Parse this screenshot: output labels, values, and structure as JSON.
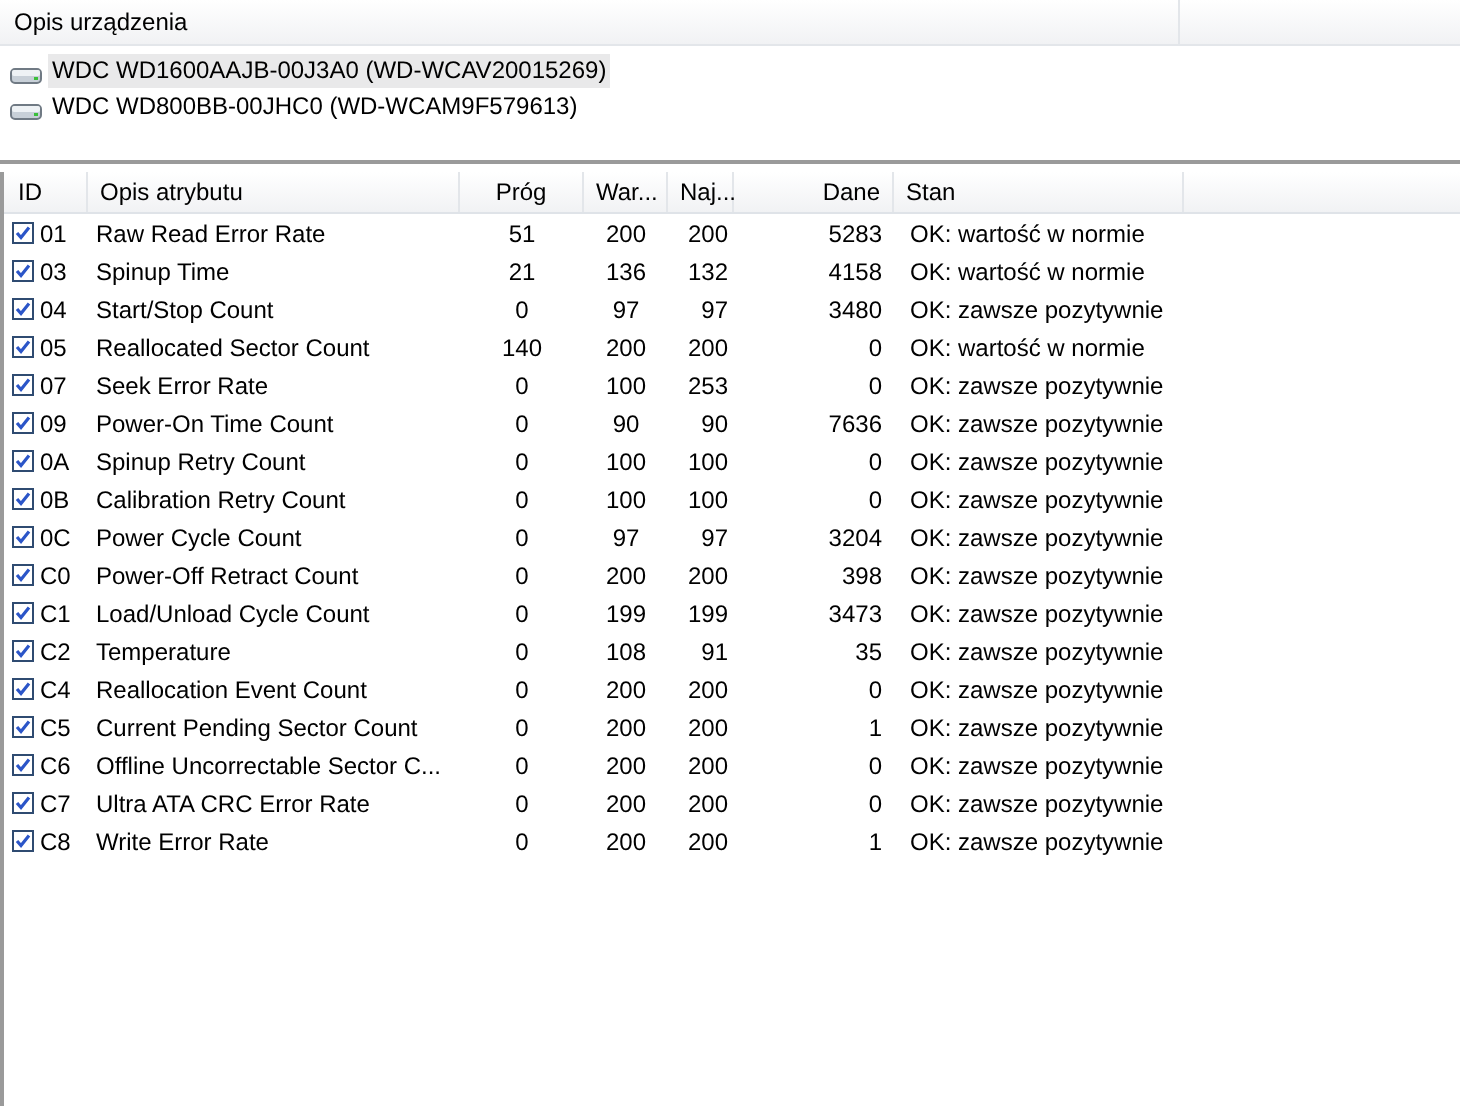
{
  "devices_panel": {
    "column_header": "Opis urządzenia",
    "devices": [
      {
        "label": "WDC WD1600AAJB-00J3A0 (WD-WCAV20015269)",
        "selected": true
      },
      {
        "label": "WDC WD800BB-00JHC0 (WD-WCAM9F579613)",
        "selected": false
      }
    ]
  },
  "attributes_table": {
    "columns": [
      "ID",
      "Opis atrybutu",
      "Próg",
      "War...",
      "Naj...",
      "Dane",
      "Stan"
    ],
    "rows": [
      {
        "checked": true,
        "id": "01",
        "name": "Raw Read Error Rate",
        "threshold": "51",
        "value": "200",
        "worst": "200",
        "data": "5283",
        "status": "OK: wartość w normie"
      },
      {
        "checked": true,
        "id": "03",
        "name": "Spinup Time",
        "threshold": "21",
        "value": "136",
        "worst": "132",
        "data": "4158",
        "status": "OK: wartość w normie"
      },
      {
        "checked": true,
        "id": "04",
        "name": "Start/Stop Count",
        "threshold": "0",
        "value": "97",
        "worst": "97",
        "data": "3480",
        "status": "OK: zawsze pozytywnie"
      },
      {
        "checked": true,
        "id": "05",
        "name": "Reallocated Sector Count",
        "threshold": "140",
        "value": "200",
        "worst": "200",
        "data": "0",
        "status": "OK: wartość w normie"
      },
      {
        "checked": true,
        "id": "07",
        "name": "Seek Error Rate",
        "threshold": "0",
        "value": "100",
        "worst": "253",
        "data": "0",
        "status": "OK: zawsze pozytywnie"
      },
      {
        "checked": true,
        "id": "09",
        "name": "Power-On Time Count",
        "threshold": "0",
        "value": "90",
        "worst": "90",
        "data": "7636",
        "status": "OK: zawsze pozytywnie"
      },
      {
        "checked": true,
        "id": "0A",
        "name": "Spinup Retry Count",
        "threshold": "0",
        "value": "100",
        "worst": "100",
        "data": "0",
        "status": "OK: zawsze pozytywnie"
      },
      {
        "checked": true,
        "id": "0B",
        "name": "Calibration Retry Count",
        "threshold": "0",
        "value": "100",
        "worst": "100",
        "data": "0",
        "status": "OK: zawsze pozytywnie"
      },
      {
        "checked": true,
        "id": "0C",
        "name": "Power Cycle Count",
        "threshold": "0",
        "value": "97",
        "worst": "97",
        "data": "3204",
        "status": "OK: zawsze pozytywnie"
      },
      {
        "checked": true,
        "id": "C0",
        "name": "Power-Off Retract Count",
        "threshold": "0",
        "value": "200",
        "worst": "200",
        "data": "398",
        "status": "OK: zawsze pozytywnie"
      },
      {
        "checked": true,
        "id": "C1",
        "name": "Load/Unload Cycle Count",
        "threshold": "0",
        "value": "199",
        "worst": "199",
        "data": "3473",
        "status": "OK: zawsze pozytywnie"
      },
      {
        "checked": true,
        "id": "C2",
        "name": "Temperature",
        "threshold": "0",
        "value": "108",
        "worst": "91",
        "data": "35",
        "status": "OK: zawsze pozytywnie"
      },
      {
        "checked": true,
        "id": "C4",
        "name": "Reallocation Event Count",
        "threshold": "0",
        "value": "200",
        "worst": "200",
        "data": "0",
        "status": "OK: zawsze pozytywnie"
      },
      {
        "checked": true,
        "id": "C5",
        "name": "Current Pending Sector Count",
        "threshold": "0",
        "value": "200",
        "worst": "200",
        "data": "1",
        "status": "OK: zawsze pozytywnie"
      },
      {
        "checked": true,
        "id": "C6",
        "name": "Offline Uncorrectable Sector C...",
        "threshold": "0",
        "value": "200",
        "worst": "200",
        "data": "0",
        "status": "OK: zawsze pozytywnie"
      },
      {
        "checked": true,
        "id": "C7",
        "name": "Ultra ATA CRC Error Rate",
        "threshold": "0",
        "value": "200",
        "worst": "200",
        "data": "0",
        "status": "OK: zawsze pozytywnie"
      },
      {
        "checked": true,
        "id": "C8",
        "name": "Write Error Rate",
        "threshold": "0",
        "value": "200",
        "worst": "200",
        "data": "1",
        "status": "OK: zawsze pozytywnie"
      }
    ]
  }
}
